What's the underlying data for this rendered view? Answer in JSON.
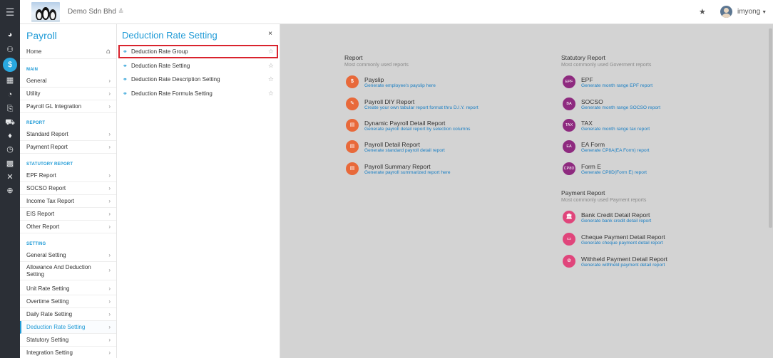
{
  "topbar": {
    "menu_icon": "hamburger-icon",
    "company": "Demo Sdn Bhd",
    "company_chevron": "≚",
    "favorite_icon": "star-icon",
    "username": "imyong"
  },
  "rail": {
    "icons": [
      "dashboard-icon",
      "people-icon",
      "payroll-icon",
      "calendar-icon",
      "clock-icon",
      "export-icon",
      "truck-icon",
      "money-bag-icon",
      "timer-icon",
      "calculator-icon",
      "tools-icon",
      "plus-circle-icon"
    ],
    "active_index": 2
  },
  "menu": {
    "title": "Payroll",
    "home": "Home",
    "sections": {
      "main": "MAIN",
      "report": "REPORT",
      "statutory": "STATUTORY REPORT",
      "setting": "SETTING"
    },
    "main_items": [
      "General",
      "Utility",
      "Payroll GL Integration"
    ],
    "report_items": [
      "Standard Report",
      "Payment Report"
    ],
    "statutory_items": [
      "EPF Report",
      "SOCSO Report",
      "Income Tax Report",
      "EIS Report",
      "Other Report"
    ],
    "setting_items": [
      "General Setting",
      "Allowance And Deduction Setting",
      "Unit Rate Setting",
      "Overtime Setting",
      "Daily Rate Setting",
      "Deduction Rate Setting",
      "Statutory Setting",
      "Integration Setting"
    ],
    "active_item": "Deduction Rate Setting"
  },
  "submenu": {
    "title": "Deduction Rate Setting",
    "close": "×",
    "items": [
      "Deduction Rate Group",
      "Deduction Rate Setting",
      "Deduction Rate Description Setting",
      "Deduction Rate Formula Setting"
    ],
    "selected_index": 0
  },
  "reports": {
    "report": {
      "title": "Report",
      "subtitle": "Most commonly used reports",
      "items": [
        {
          "name": "Payslip",
          "desc": "Generate employee's payslip here",
          "icon": "dollar-icon",
          "badge": "$"
        },
        {
          "name": "Payroll DIY Report",
          "desc": "Create your own tabular report format thru D.I.Y. report",
          "icon": "pencil-icon",
          "badge": "✎"
        },
        {
          "name": "Dynamic Payroll Detail Report",
          "desc": "Generate payroll detail report by selection columns",
          "icon": "document-icon",
          "badge": "▤"
        },
        {
          "name": "Payroll Detail Report",
          "desc": "Generate standard payroll detail report",
          "icon": "document-icon",
          "badge": "▤"
        },
        {
          "name": "Payroll Summary Report",
          "desc": "Generate payroll summarized report here",
          "icon": "document-icon",
          "badge": "▤"
        }
      ]
    },
    "statutory": {
      "title": "Statutory Report",
      "subtitle": "Most commonly used Goverment reports",
      "items": [
        {
          "name": "EPF",
          "desc": "Generate month range EPF report",
          "badge": "EPF"
        },
        {
          "name": "SOCSO",
          "desc": "Generate month range SOCSO report",
          "badge": "BA"
        },
        {
          "name": "TAX",
          "desc": "Generate month range tax report",
          "badge": "TAX"
        },
        {
          "name": "EA Form",
          "desc": "Generate CP8A(EA Form) report",
          "badge": "EA"
        },
        {
          "name": "Form E",
          "desc": "Generate CP8D(Form E) report",
          "badge": "CP8D"
        }
      ]
    },
    "payment": {
      "title": "Payment Report",
      "subtitle": "Most commonly used Payment reports",
      "items": [
        {
          "name": "Bank Credit Detail Report",
          "desc": "Generate bank credit detail report",
          "icon": "bank-icon",
          "badge": "🏛"
        },
        {
          "name": "Cheque Payment Detail Report",
          "desc": "Generate cheque payment detail report",
          "icon": "cheque-icon",
          "badge": "▭"
        },
        {
          "name": "Withheld Payment Detail Report",
          "desc": "Generate withheld payment detail report",
          "icon": "prohibited-icon",
          "badge": "⊘"
        }
      ]
    }
  },
  "colors": {
    "accent": "#1e9ad6",
    "rail": "#2b2f36",
    "orange": "#e8693a",
    "purple": "#8e2a7f",
    "pink": "#e0457b",
    "highlight_border": "#d9232d"
  }
}
